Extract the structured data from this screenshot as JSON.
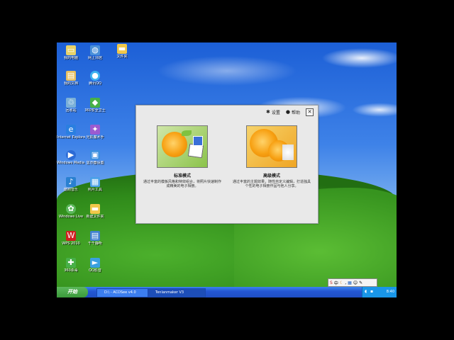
{
  "desktop_icons": [
    {
      "label": "我的电脑",
      "icon": "computer-icon",
      "color": "#e8d26a"
    },
    {
      "label": "网上邻居",
      "icon": "network-icon",
      "color": "#4a90d9"
    },
    {
      "label": "文件夹",
      "icon": "folder-icon",
      "color": "#f0c84a"
    },
    {
      "label": "我的文档",
      "icon": "documents-icon",
      "color": "#e8c060"
    },
    {
      "label": "腾讯QQ",
      "icon": "qq-icon",
      "color": "#3db2f0"
    },
    {
      "label": "回收站",
      "icon": "recycle-bin-icon",
      "color": "#7bb0d8"
    },
    {
      "label": "360安全卫士",
      "icon": "shield-icon",
      "color": "#47b047"
    },
    {
      "label": "Internet Explorer",
      "icon": "ie-icon",
      "color": "#2a7fe0"
    },
    {
      "label": "光影魔术手",
      "icon": "camera-icon",
      "color": "#9b5bd0"
    },
    {
      "label": "Windows Media Player",
      "icon": "media-icon",
      "color": "#2c6bd6"
    },
    {
      "label": "显示器设置",
      "icon": "monitor-icon",
      "color": "#3a8fe0"
    },
    {
      "label": "酷狗音乐",
      "icon": "music-icon",
      "color": "#2a80d0"
    },
    {
      "label": "照片工具",
      "icon": "photo-icon",
      "color": "#4aa0e8"
    },
    {
      "label": "Windows Live",
      "icon": "live-icon",
      "color": "#5cb85c"
    },
    {
      "label": "新建文件夹",
      "icon": "folder-icon",
      "color": "#f0c84a"
    },
    {
      "label": "WPS 2010",
      "icon": "wps-icon",
      "color": "#d02020"
    },
    {
      "label": "千千静听",
      "icon": "player-icon",
      "color": "#4080d0"
    },
    {
      "label": "360杀毒",
      "icon": "antivirus-icon",
      "color": "#48b048"
    },
    {
      "label": "QQ影音",
      "icon": "video-icon",
      "color": "#3aa0e0"
    }
  ],
  "dialog": {
    "settings_label": "设置",
    "help_label": "帮助",
    "close_glyph": "✕",
    "modes": [
      {
        "title": "标准模式",
        "desc": "通过丰富的模板风格和特效组合，将照片快速制作成精美的电子相册。"
      },
      {
        "title": "高级模式",
        "desc": "通过丰富的主题效果，随性自定义编辑，打造独具个性的电子相册作品与他人分享。"
      }
    ]
  },
  "taskbar": {
    "start_label": "开始",
    "tasks": [
      {
        "label": "D:\\ - ACDSee v4.0",
        "active": false
      },
      {
        "label": "Tenlanmaker V3",
        "active": true
      }
    ],
    "clock": "8:40"
  },
  "ime_label": "中"
}
